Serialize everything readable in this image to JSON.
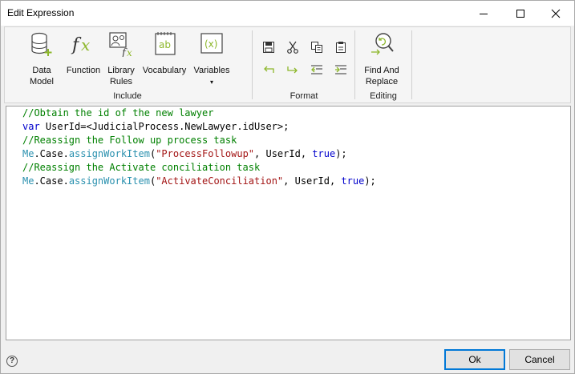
{
  "window": {
    "title": "Edit Expression",
    "controls": {
      "minimize": "minimize-icon",
      "maximize": "maximize-icon",
      "close": "close-icon"
    }
  },
  "ribbon": {
    "groups": [
      {
        "label": "Include",
        "buttons": [
          {
            "label_line1": "Data",
            "label_line2": "Model",
            "icon": "database-add-icon"
          },
          {
            "label_line1": "Function",
            "label_line2": "",
            "icon": "fx-icon"
          },
          {
            "label_line1": "Library",
            "label_line2": "Rules",
            "icon": "library-rules-icon"
          },
          {
            "label_line1": "Vocabulary",
            "label_line2": "",
            "icon": "vocabulary-icon"
          },
          {
            "label_line1": "Variables",
            "label_line2": "▾",
            "icon": "variables-icon"
          }
        ]
      },
      {
        "label": "Format",
        "buttons": [
          "save-icon",
          "cut-icon",
          "copy-icon",
          "paste-icon",
          "undo-icon",
          "redo-icon",
          "outdent-icon",
          "indent-icon"
        ]
      },
      {
        "label": "Editing",
        "buttons": [
          {
            "label_line1": "Find And",
            "label_line2": "Replace",
            "icon": "find-replace-icon"
          }
        ]
      }
    ]
  },
  "editor": {
    "lines": [
      [
        {
          "t": "//Obtain the id of the new lawyer",
          "c": "comment"
        }
      ],
      [
        {
          "t": "var",
          "c": "kw"
        },
        {
          "t": " UserId=<JudicialProcess.NewLawyer.idUser>;",
          "c": "plain"
        }
      ],
      [
        {
          "t": "//Reassign the Follow up process task",
          "c": "comment"
        }
      ],
      [
        {
          "t": "Me",
          "c": "type"
        },
        {
          "t": ".Case.",
          "c": "plain"
        },
        {
          "t": "assignWorkItem",
          "c": "type"
        },
        {
          "t": "(",
          "c": "plain"
        },
        {
          "t": "\"ProcessFollowup\"",
          "c": "str"
        },
        {
          "t": ", UserId, ",
          "c": "plain"
        },
        {
          "t": "true",
          "c": "kw"
        },
        {
          "t": ");",
          "c": "plain"
        }
      ],
      [
        {
          "t": "//Reassign the Activate conciliation task",
          "c": "comment"
        }
      ],
      [
        {
          "t": "Me",
          "c": "type"
        },
        {
          "t": ".Case.",
          "c": "plain"
        },
        {
          "t": "assignWorkItem",
          "c": "type"
        },
        {
          "t": "(",
          "c": "plain"
        },
        {
          "t": "\"ActivateConciliation\"",
          "c": "str"
        },
        {
          "t": ", UserId, ",
          "c": "plain"
        },
        {
          "t": "true",
          "c": "kw"
        },
        {
          "t": ");",
          "c": "plain"
        }
      ]
    ]
  },
  "footer": {
    "help": "?",
    "ok_label": "Ok",
    "cancel_label": "Cancel"
  },
  "colors": {
    "comment": "#008000",
    "keyword": "#0000cc",
    "type": "#2b91af",
    "string": "#a31515",
    "accent": "#0078d7",
    "icon_green": "#8db72b"
  }
}
